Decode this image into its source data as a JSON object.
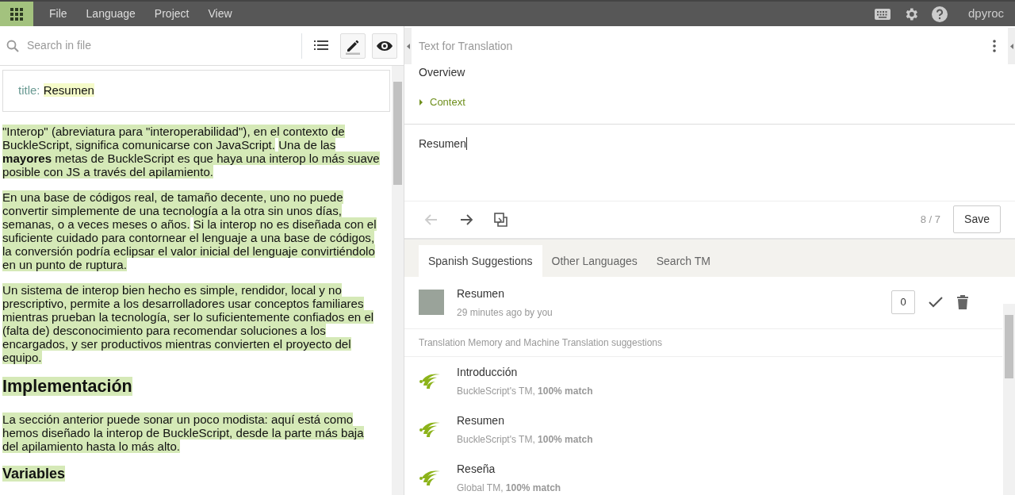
{
  "menu_bar": {
    "items": [
      "File",
      "Language",
      "Project",
      "View"
    ],
    "user": "dpyroc"
  },
  "file_pane": {
    "search": {
      "placeholder": "Search in file"
    },
    "view_buttons": [
      {
        "kind": "outline",
        "pressed": false
      },
      {
        "kind": "edit",
        "pressed": true
      },
      {
        "kind": "preview",
        "pressed": true
      }
    ],
    "title_field": {
      "label": "title:",
      "value": "Resumen"
    },
    "blocks": [
      {
        "kind": "paragraph",
        "segments": [
          "\"Interop\" (abreviatura para \"interoperabilidad\"), en el contexto de BuckleScript, significa comunicarse con JavaScript.",
          "Una de las **mayores** metas de BuckleScript es que haya una interop lo más suave posible con JS a través del apilamiento."
        ]
      },
      {
        "kind": "paragraph",
        "segments": [
          "En una base de códigos real, de tamaño decente, uno no puede convertir simplemente de una tecnología a la otra sin unos días, semanas, o a veces meses o años.",
          "Si la interop no es diseñada con el suficiente cuidado para contornear el lenguaje a una base de códigos, la conversión podría eclipsar el valor inicial del lenguaje convirtiéndolo en un punto de ruptura."
        ]
      },
      {
        "kind": "paragraph",
        "segments": [
          "Un sistema de interop bien hecho es simple, rendidor, local y no prescriptivo, permite a los desarrolladores usar conceptos familiares mientras prueban la tecnología, ser lo suficientemente confiados en el (falta de) desconocimiento para recomendar soluciones a los encargados, y ser productivos mientras convierten el proyecto del equipo."
        ]
      },
      {
        "kind": "heading",
        "segments": [
          "Implementación"
        ]
      },
      {
        "kind": "paragraph",
        "segments": [
          "La sección anterior puede sonar un poco modista: aquí está como hemos diseñado la interop de BuckleScript, desde la parte más baja del apilamiento hasta lo más alto."
        ]
      },
      {
        "kind": "subheading",
        "segments": [
          "Variables"
        ]
      }
    ]
  },
  "translation_panel": {
    "title": "Text for Translation",
    "overview": "Overview",
    "context": {
      "label": "Context",
      "expanded": false
    },
    "editor_value": "Resumen",
    "nav_buttons": [
      {
        "kind": "back",
        "disabled": true
      },
      {
        "kind": "forward",
        "disabled": false
      },
      {
        "kind": "copy",
        "disabled": false
      }
    ],
    "counter": "8 / 7",
    "save": "Save"
  },
  "suggestions": {
    "tabs": [
      {
        "label": "Spanish Suggestions",
        "selected": true
      },
      {
        "label": "Other Languages",
        "selected": false
      },
      {
        "label": "Search TM",
        "selected": false
      }
    ],
    "own": [
      {
        "text": "Resumen",
        "meta": "29 minutes ago by you",
        "votes": "0"
      }
    ],
    "section_label": "Translation Memory and Machine Translation suggestions",
    "tm": [
      {
        "text": "Introducción",
        "meta": "BuckleScript's TM, **100% match**"
      },
      {
        "text": "Resumen",
        "meta": "BuckleScript's TM, **100% match**"
      },
      {
        "text": "Reseña",
        "meta": "Global TM, **100% match**"
      }
    ]
  }
}
